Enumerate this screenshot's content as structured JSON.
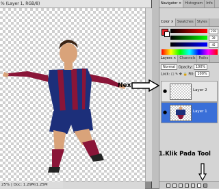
{
  "document": {
    "title": "% (Layer 1, RGB/8)",
    "status": "25% | Doc: 1.29M/1.25M"
  },
  "panels": {
    "navigator_tabs": [
      "Navigator ×",
      "Histogram",
      "Info"
    ],
    "color_tabs": [
      "Color ×",
      "Swatches",
      "Styles"
    ],
    "color": {
      "foreground": "#e4272d",
      "background": "#ffffff",
      "r": "228",
      "g": "39",
      "b": "45"
    },
    "layers_tabs": [
      "Layers ×",
      "Channels",
      "Paths"
    ],
    "blend_mode": "Normal",
    "opacity_label": "Opacity:",
    "opacity_value": "100%",
    "lock_label": "Lock:",
    "fill_label": "Fill:",
    "fill_value": "100%",
    "layers": [
      {
        "name": "Layer 2",
        "active": false,
        "visible": true
      },
      {
        "name": "Layer 1",
        "active": true,
        "visible": true
      }
    ]
  },
  "annotations": {
    "next": "Next",
    "klik": "1.Klik Pada Tool"
  },
  "colors": {
    "annotation_arrow": "#000000",
    "active_layer": "#3a6fd8"
  }
}
